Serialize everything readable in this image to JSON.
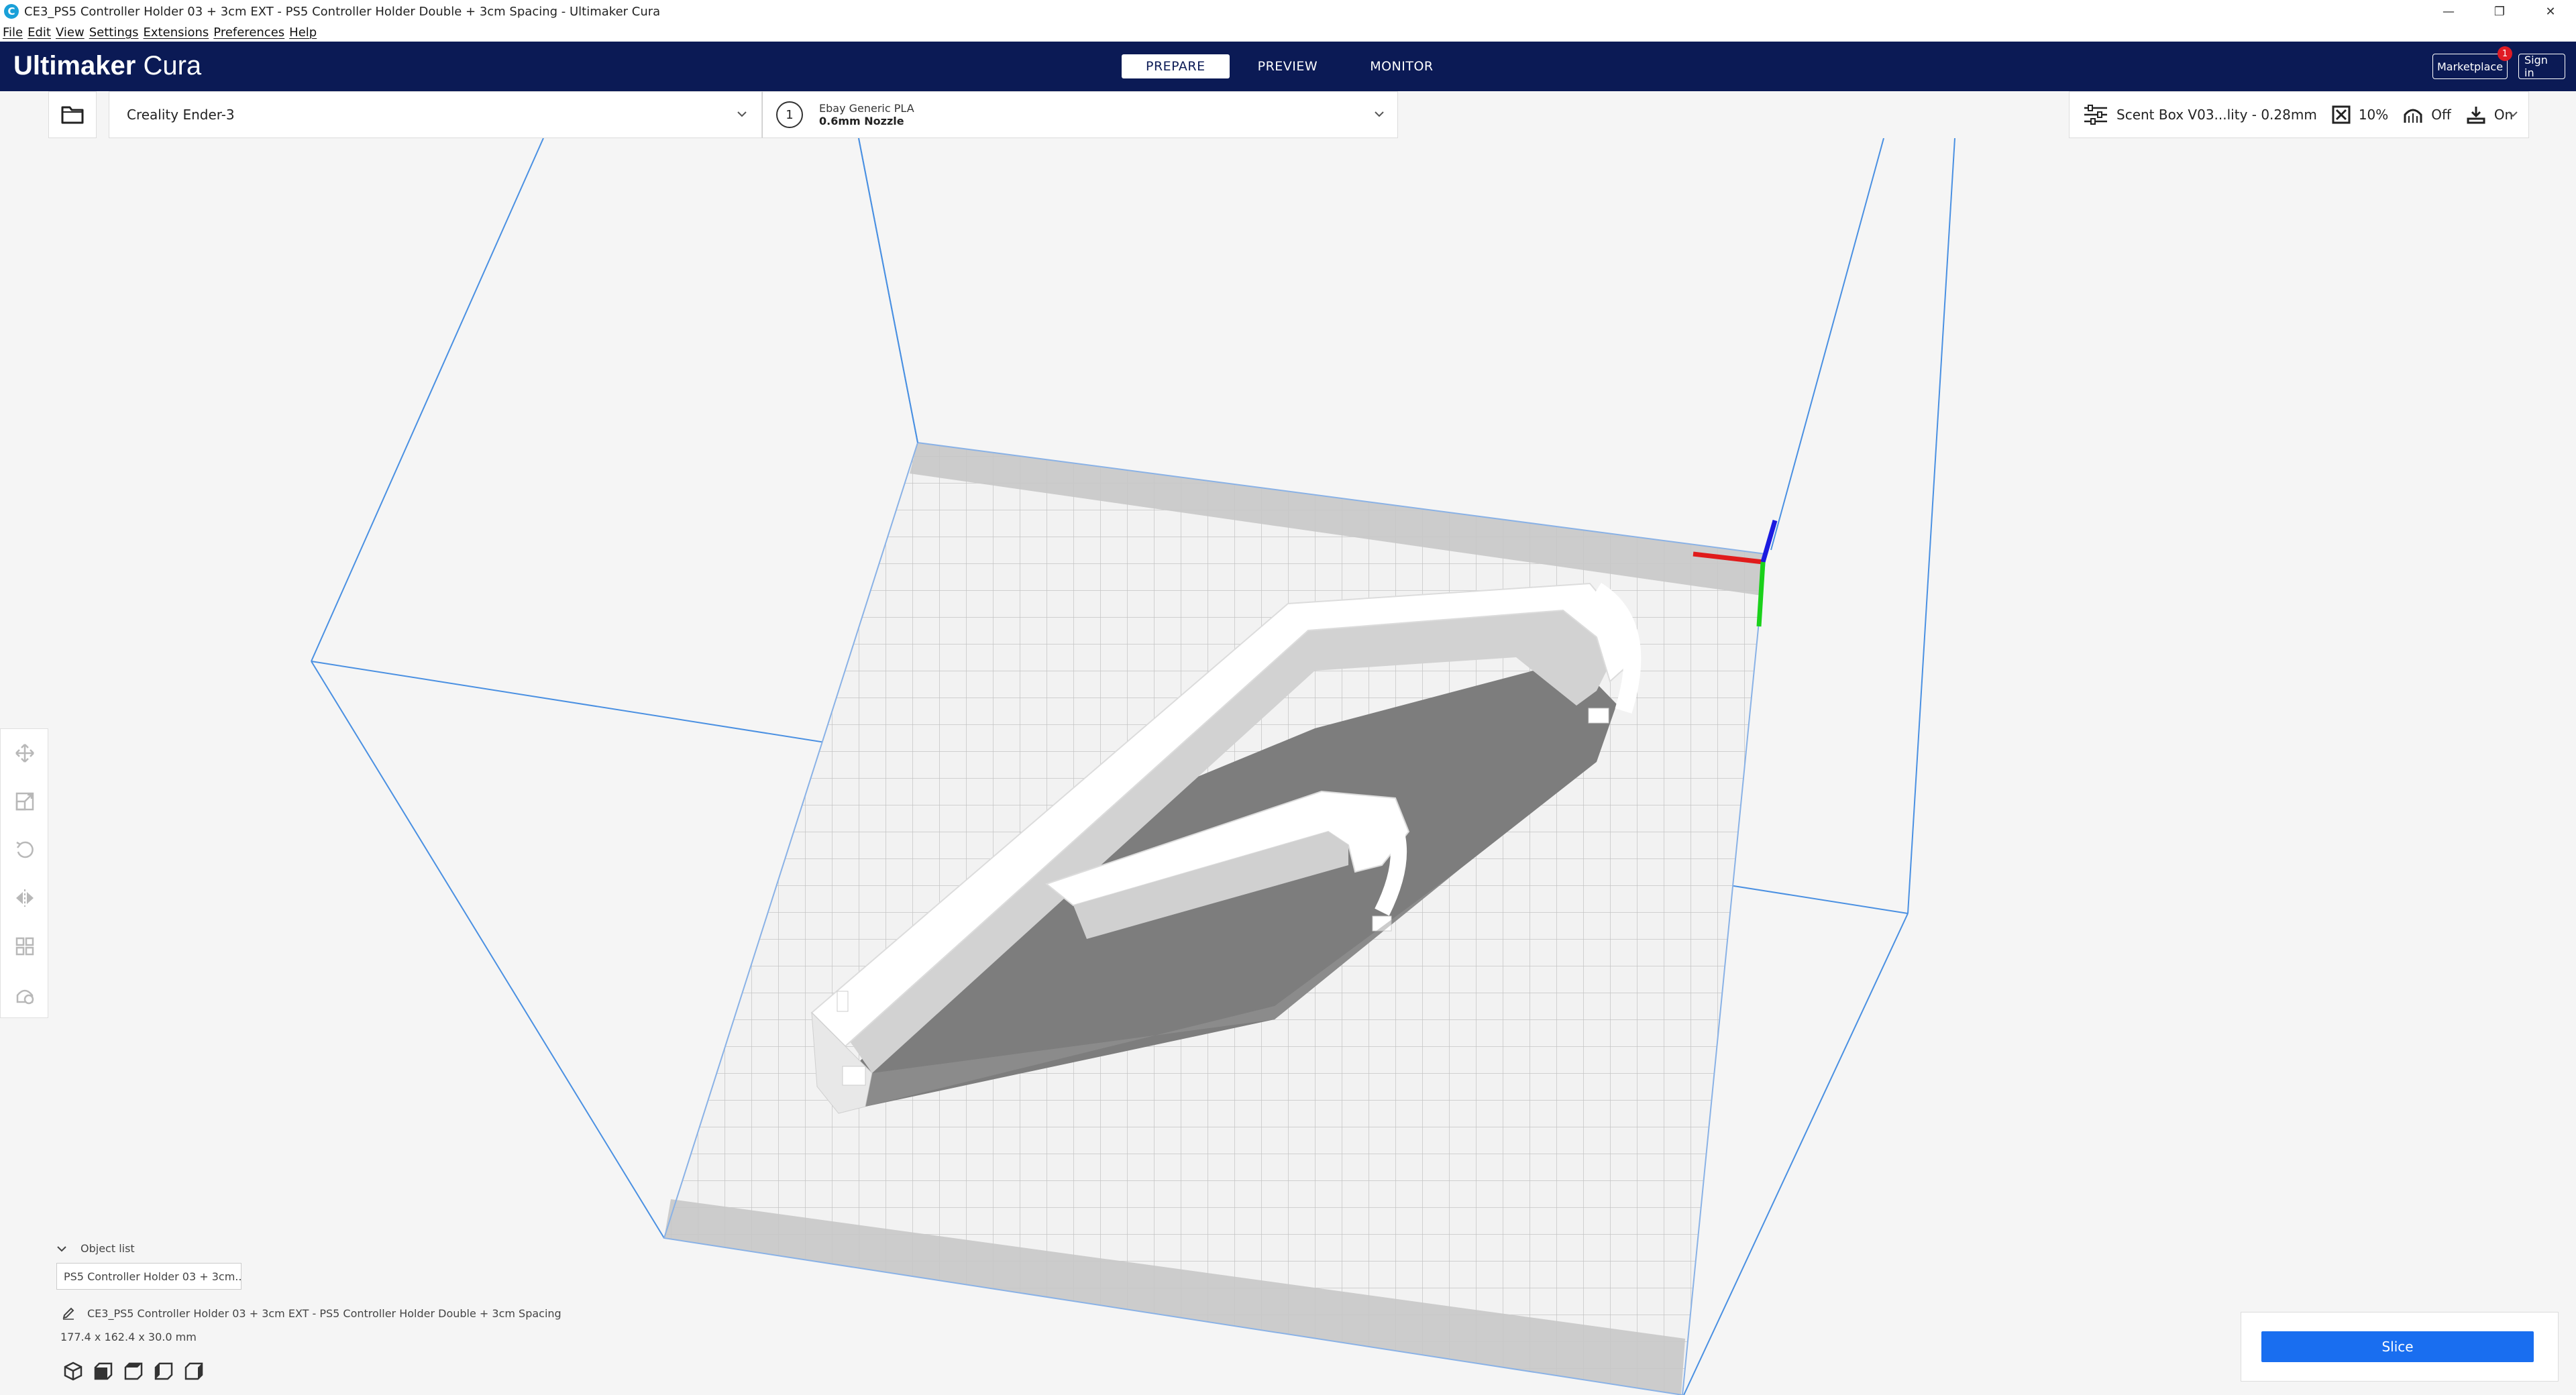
{
  "window": {
    "title": "CE3_PS5 Controller Holder 03 + 3cm EXT - PS5 Controller Holder Double + 3cm Spacing - Ultimaker Cura",
    "app_icon_glyph": "C",
    "minimize": "—",
    "maximize": "❐",
    "close": "✕"
  },
  "menu": [
    "File",
    "Edit",
    "View",
    "Settings",
    "Extensions",
    "Preferences",
    "Help"
  ],
  "header": {
    "brand_bold": "Ultimaker",
    "brand_light": "Cura",
    "tabs": [
      {
        "label": "PREPARE",
        "active": true
      },
      {
        "label": "PREVIEW",
        "active": false
      },
      {
        "label": "MONITOR",
        "active": false
      }
    ],
    "marketplace": "Marketplace",
    "marketplace_badge": "1",
    "sign_in": "Sign in"
  },
  "toolbar": {
    "printer": "Creality Ender-3",
    "extruder_number": "1",
    "material": "Ebay Generic PLA",
    "nozzle": "0.6mm Nozzle",
    "profile": "Scent Box V03...lity - 0.28mm",
    "infill": "10%",
    "support": "Off",
    "adhesion": "On"
  },
  "object_list": {
    "header": "Object list",
    "item": "PS5 Controller Holder 03 + 3cm...",
    "project_name": "CE3_PS5 Controller Holder 03 + 3cm EXT - PS5 Controller Holder Double + 3cm Spacing",
    "dimensions": "177.4 x 162.4 x 30.0 mm"
  },
  "slice": {
    "label": "Slice"
  },
  "colors": {
    "header_bg": "#0b1a55",
    "accent": "#196ef0",
    "build_volume_line": "#4a90e2",
    "axis_x": "#e01b1b",
    "axis_y": "#1bd11b",
    "axis_z": "#1b1be0"
  }
}
